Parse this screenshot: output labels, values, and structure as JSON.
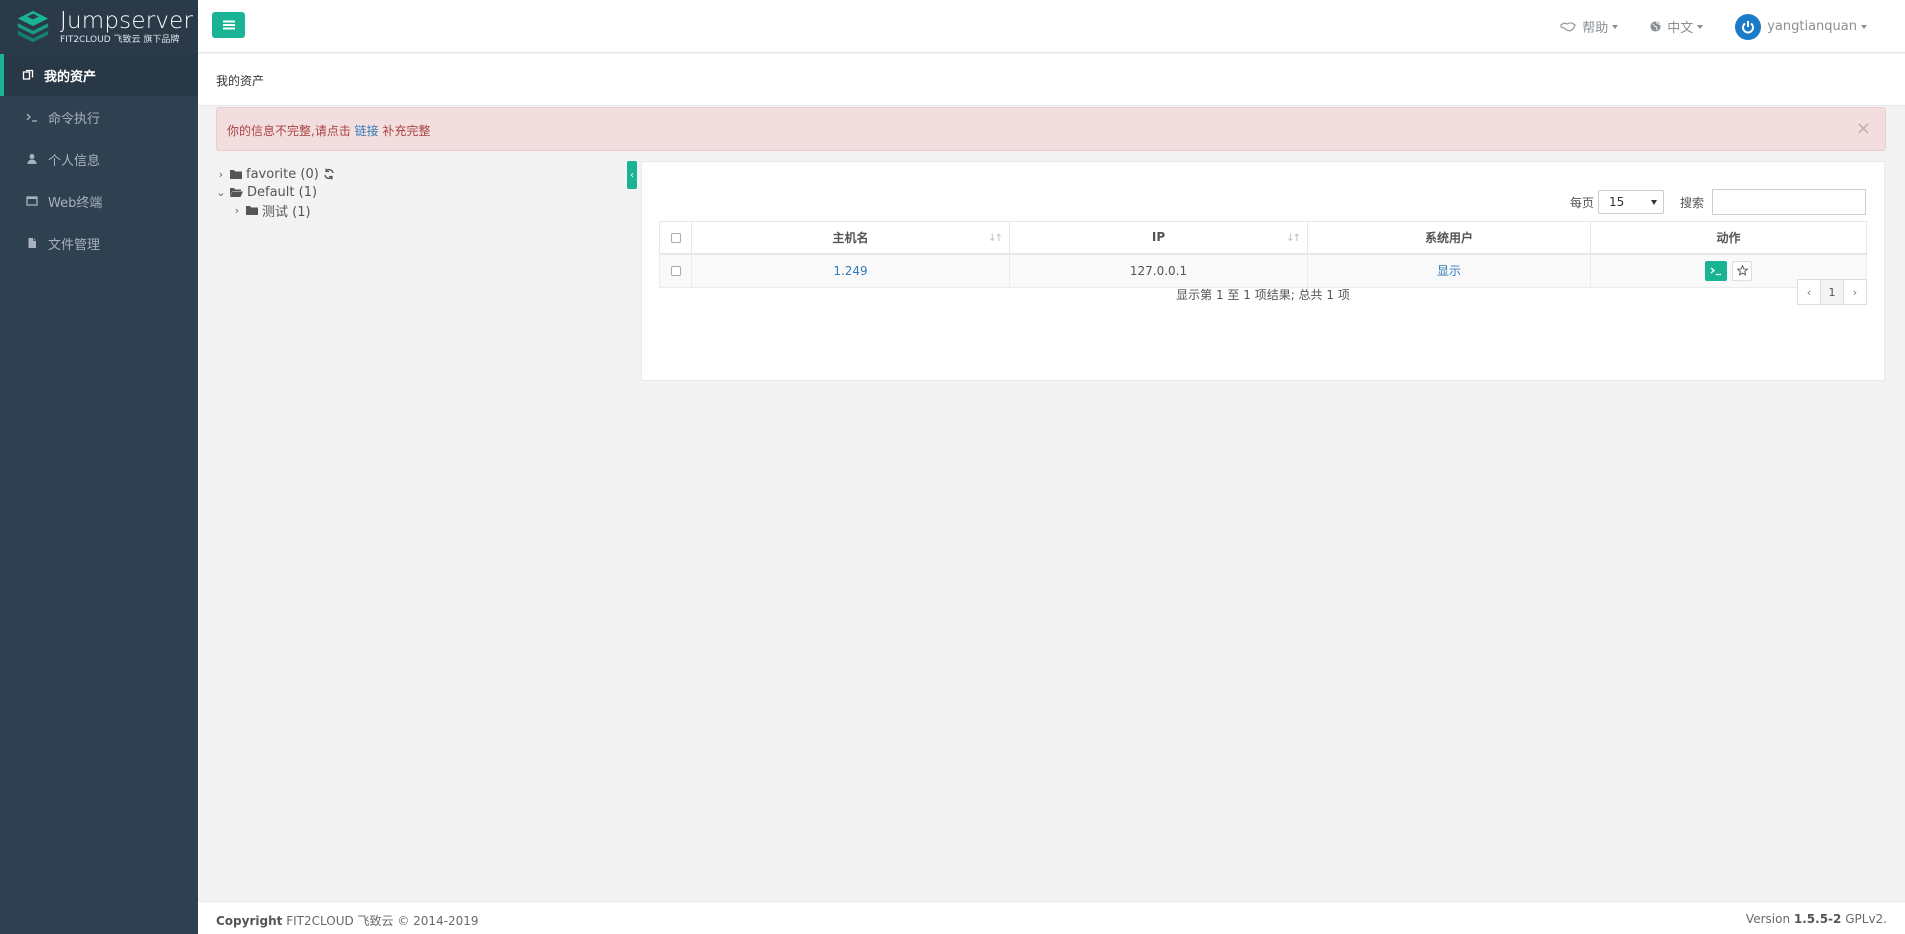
{
  "brand": {
    "title": "Jumpserver",
    "subtitle": "FIT2CLOUD 飞致云 旗下品牌"
  },
  "sidebar": {
    "items": [
      {
        "label": "我的资产",
        "icon": "cube-icon",
        "active": true
      },
      {
        "label": "命令执行",
        "icon": "terminal-icon",
        "active": false
      },
      {
        "label": "个人信息",
        "icon": "user-icon",
        "active": false
      },
      {
        "label": "Web终端",
        "icon": "window-icon",
        "active": false
      },
      {
        "label": "文件管理",
        "icon": "file-icon",
        "active": false
      }
    ]
  },
  "topbar": {
    "help": "帮助",
    "language": "中文",
    "username": "yangtianquan"
  },
  "page": {
    "breadcrumb": "我的资产"
  },
  "alert": {
    "text_before": "你的信息不完整,请点击",
    "link": "链接",
    "text_after": "补充完整",
    "close": "×"
  },
  "tree": {
    "nodes": [
      {
        "label": "favorite (0)",
        "expanded": false,
        "level": 1
      },
      {
        "label": "Default (1)",
        "expanded": true,
        "level": 1
      },
      {
        "label": "测试 (1)",
        "expanded": false,
        "level": 2
      }
    ]
  },
  "table": {
    "per_page_label": "每页",
    "per_page_value": "15",
    "search_label": "搜索",
    "search_value": "",
    "columns": [
      "主机名",
      "IP",
      "系统用户",
      "动作"
    ],
    "rows": [
      {
        "hostname": "1.249",
        "ip": "127.0.0.1",
        "system_user": "显示"
      }
    ],
    "info": "显示第 1 至 1 项结果; 总共 1 项",
    "pager": {
      "prev": "‹",
      "current": "1",
      "next": "›"
    }
  },
  "footer": {
    "copyright_label": "Copyright",
    "copyright_text": "FIT2CLOUD 飞致云 © 2014-2019",
    "version_label": "Version",
    "version": "1.5.5-2",
    "license": "GPLv2."
  },
  "colors": {
    "sidebar_bg": "#2f4050",
    "accent": "#1ab394",
    "link": "#337ab7",
    "alert_bg": "#f2dede",
    "alert_text": "#a94442"
  }
}
